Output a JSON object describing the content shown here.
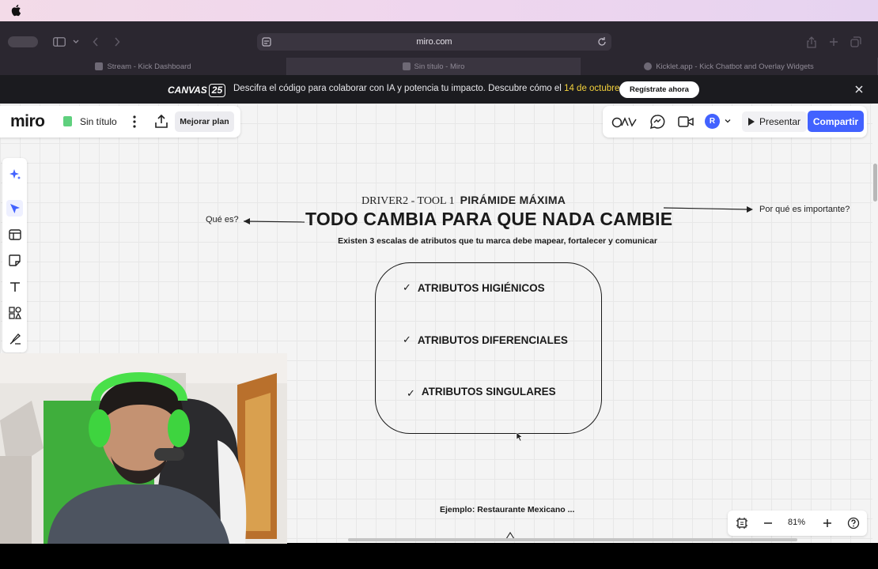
{
  "browser": {
    "url": "miro.com",
    "tabs": [
      {
        "label": "Stream - Kick Dashboard"
      },
      {
        "label": "Sin título - Miro"
      },
      {
        "label": "Kicklet.app - Kick Chatbot and Overlay Widgets"
      }
    ]
  },
  "banner": {
    "logo_word": "CANVAS",
    "logo_num": "25",
    "message": "Descifra el código para colaborar con IA y potencia tu impacto. Descubre cómo el ",
    "date": "14 de octubre.",
    "cta": "Regístrate ahora"
  },
  "miro": {
    "logo": "miro",
    "board_title": "Sin título",
    "upgrade_label": "Mejorar plan",
    "avatar_initial": "R",
    "present_label": "Presentar",
    "share_label": "Compartir",
    "zoom_level": "81%",
    "accent": "#4262ff"
  },
  "board": {
    "driver_prefix": "DRIVER2 - TOOL 1",
    "driver_title": "PIRÁMIDE MÁXIMA",
    "headline": "TODO CAMBIA PARA QUE NADA CAMBIE",
    "subtitle": "Existen 3 escalas de atributos que tu marca debe mapear, fortalecer y comunicar",
    "left_label": "Qué es?",
    "right_label": "Por qué es importante?",
    "check": "✓",
    "attributes": [
      "ATRIBUTOS HIGIÉNICOS",
      "ATRIBUTOS DIFERENCIALES",
      "ATRIBUTOS SINGULARES"
    ],
    "example": "Ejemplo: Restaurante Mexicano ..."
  }
}
